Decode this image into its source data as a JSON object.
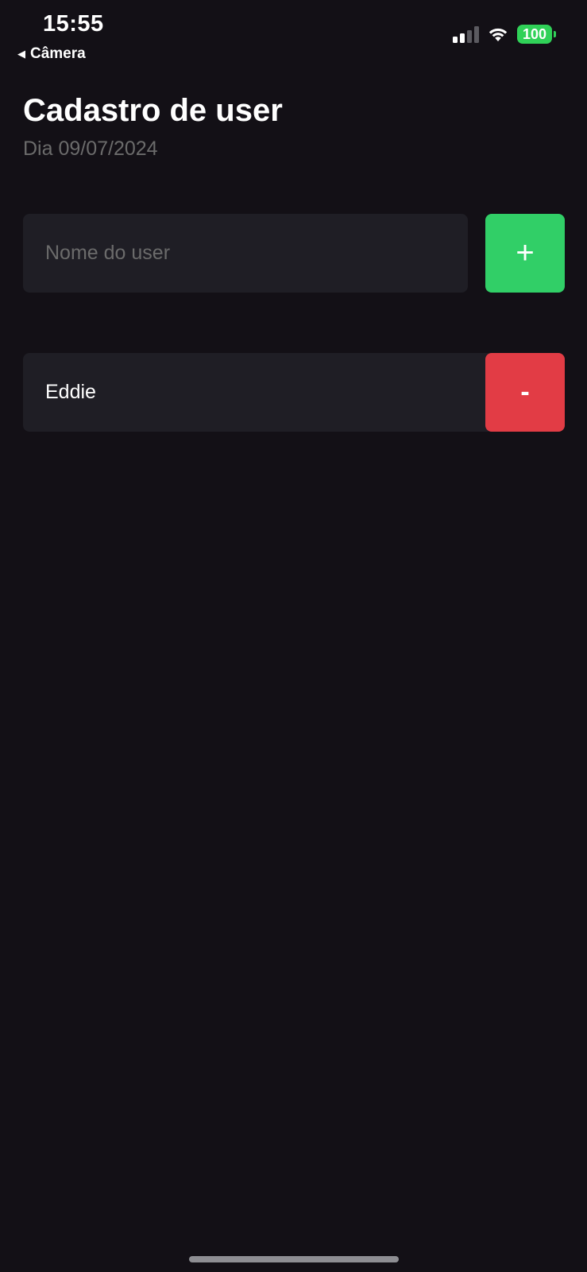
{
  "status_bar": {
    "time": "15:55",
    "back_label": "Câmera",
    "battery": "100",
    "battery_color": "#30d158",
    "icons": [
      "cellular-signal-icon",
      "wifi-icon",
      "battery-icon"
    ]
  },
  "header": {
    "title": "Cadastro de user",
    "subtitle": "Dia 09/07/2024"
  },
  "form": {
    "name_placeholder": "Nome do user",
    "name_value": "",
    "add_label": "+",
    "add_color": "#31cf67"
  },
  "users": [
    {
      "name": "Eddie",
      "remove_label": "-",
      "remove_color": "#e23c45"
    }
  ],
  "colors": {
    "background": "#131016",
    "card": "#1f1e25",
    "muted_text": "#6b6b6b"
  }
}
